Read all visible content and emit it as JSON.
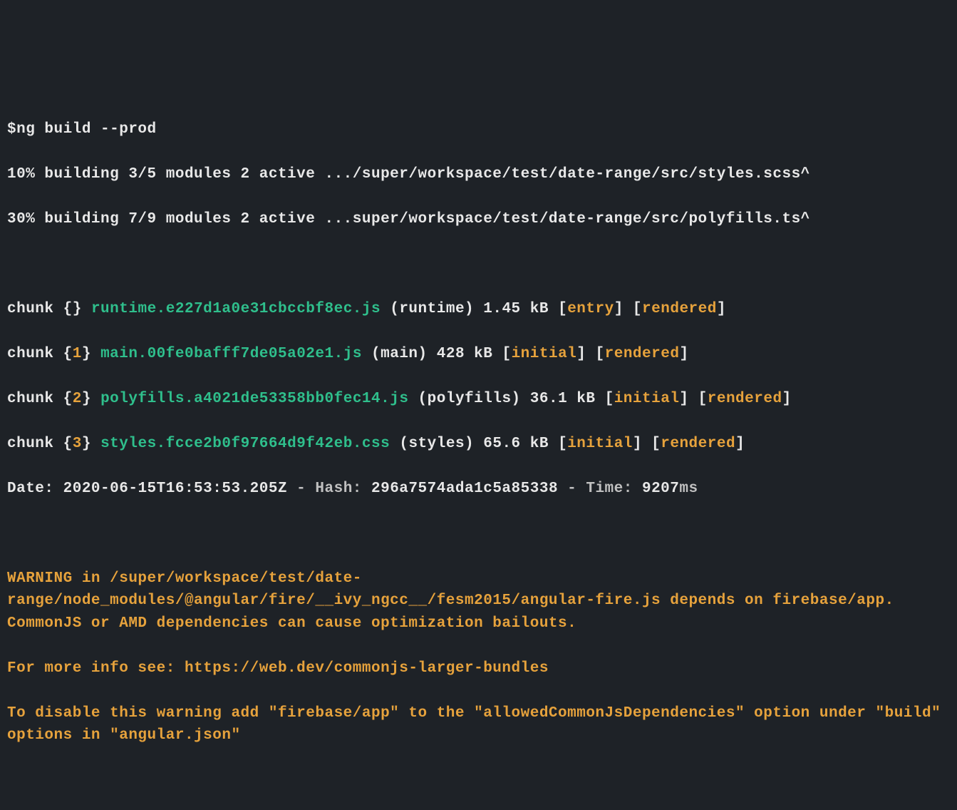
{
  "cmd": "$ng build --prod",
  "progress": [
    "10% building 3/5 modules 2 active .../super/workspace/test/date-range/src/styles.scss^",
    "30% building 7/9 modules 2 active ...super/workspace/test/date-range/src/polyfills.ts^"
  ],
  "chunks": [
    {
      "pre": "chunk ",
      "brace_open": "{",
      "idx": "",
      "brace_close": "}",
      "sp": " ",
      "file": "runtime.e227d1a0e31cbccbf8ec.js",
      "meta": " (runtime) 1.45 kB ",
      "f1o": "[",
      "f1": "entry",
      "f1c": "]",
      "sp2": " ",
      "f2o": "[",
      "f2": "rendered",
      "f2c": "]"
    },
    {
      "pre": "chunk ",
      "brace_open": "{",
      "idx": "1",
      "brace_close": "}",
      "sp": " ",
      "file": "main.00fe0bafff7de05a02e1.js",
      "meta": " (main) 428 kB ",
      "f1o": "[",
      "f1": "initial",
      "f1c": "]",
      "sp2": " ",
      "f2o": "[",
      "f2": "rendered",
      "f2c": "]"
    },
    {
      "pre": "chunk ",
      "brace_open": "{",
      "idx": "2",
      "brace_close": "}",
      "sp": " ",
      "file": "polyfills.a4021de53358bb0fec14.js",
      "meta": " (polyfills) 36.1 kB ",
      "f1o": "[",
      "f1": "initial",
      "f1c": "]",
      "sp2": " ",
      "f2o": "[",
      "f2": "rendered",
      "f2c": "]"
    },
    {
      "pre": "chunk ",
      "brace_open": "{",
      "idx": "3",
      "brace_close": "}",
      "sp": " ",
      "file": "styles.fcce2b0f97664d9f42eb.css",
      "meta": " (styles) 65.6 kB ",
      "f1o": "[",
      "f1": "initial",
      "f1c": "]",
      "sp2": " ",
      "f2o": "[",
      "f2": "rendered",
      "f2c": "]"
    }
  ],
  "summary": {
    "l1": "Date: ",
    "date": "2020-06-15T16:53:53.205Z",
    "l2": " - Hash: ",
    "hash": "296a7574ada1c5a85338",
    "l3": " - Time: ",
    "time": "9207",
    "l4": "ms"
  },
  "warning": [
    "WARNING in /super/workspace/test/date-range/node_modules/@angular/fire/__ivy_ngcc__/fesm2015/angular-fire.js depends on firebase/app. CommonJS or AMD dependencies can cause optimization bailouts.",
    "For more info see: https://web.dev/commonjs-larger-bundles",
    "To disable this warning add \"firebase/app\" to the \"allowedCommonJsDependencies\" option under \"build\" options in \"angular.json\""
  ]
}
